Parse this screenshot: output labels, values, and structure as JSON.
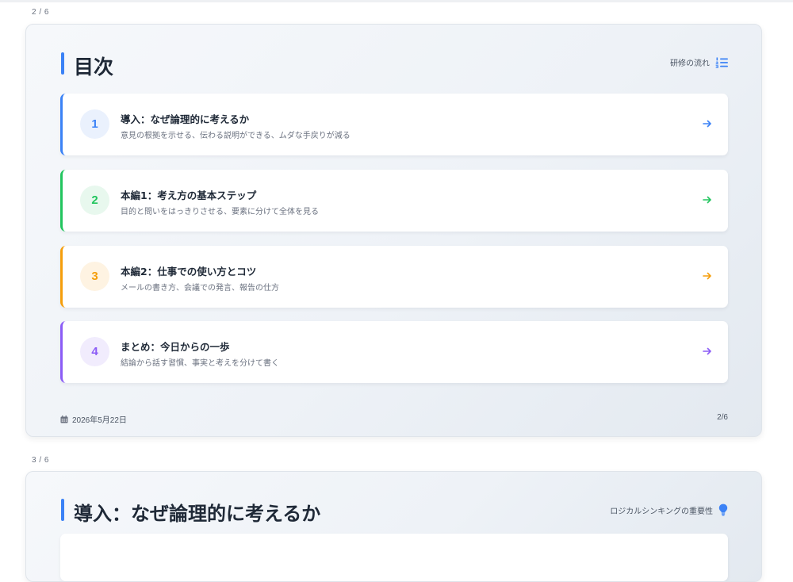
{
  "slides": [
    {
      "indicator": "2 / 6",
      "title": "目次",
      "header_label": "研修の流れ",
      "header_icon": "list-ordered-icon",
      "items": [
        {
          "number": "1",
          "title": "導入：なぜ論理的に考えるか",
          "description": "意見の根拠を示せる、伝わる説明ができる、ムダな手戻りが減る",
          "color": "#3b82f6",
          "bg": "#eaf1fd"
        },
        {
          "number": "2",
          "title": "本編1：考え方の基本ステップ",
          "description": "目的と問いをはっきりさせる、要素に分けて全体を見る",
          "color": "#22c55e",
          "bg": "#e8f8ee"
        },
        {
          "number": "3",
          "title": "本編2：仕事での使い方とコツ",
          "description": "メールの書き方、会議での発言、報告の仕方",
          "color": "#f59e0b",
          "bg": "#fef3e2"
        },
        {
          "number": "4",
          "title": "まとめ：今日からの一歩",
          "description": "結論から話す習慣、事実と考えを分けて書く",
          "color": "#8b5cf6",
          "bg": "#f1ecfd"
        }
      ],
      "footer_date": "2026年5月22日",
      "footer_page": "2/6"
    },
    {
      "indicator": "3 / 6",
      "title": "導入：なぜ論理的に考えるか",
      "header_label": "ロジカルシンキングの重要性",
      "header_icon": "lightbulb-icon"
    }
  ]
}
